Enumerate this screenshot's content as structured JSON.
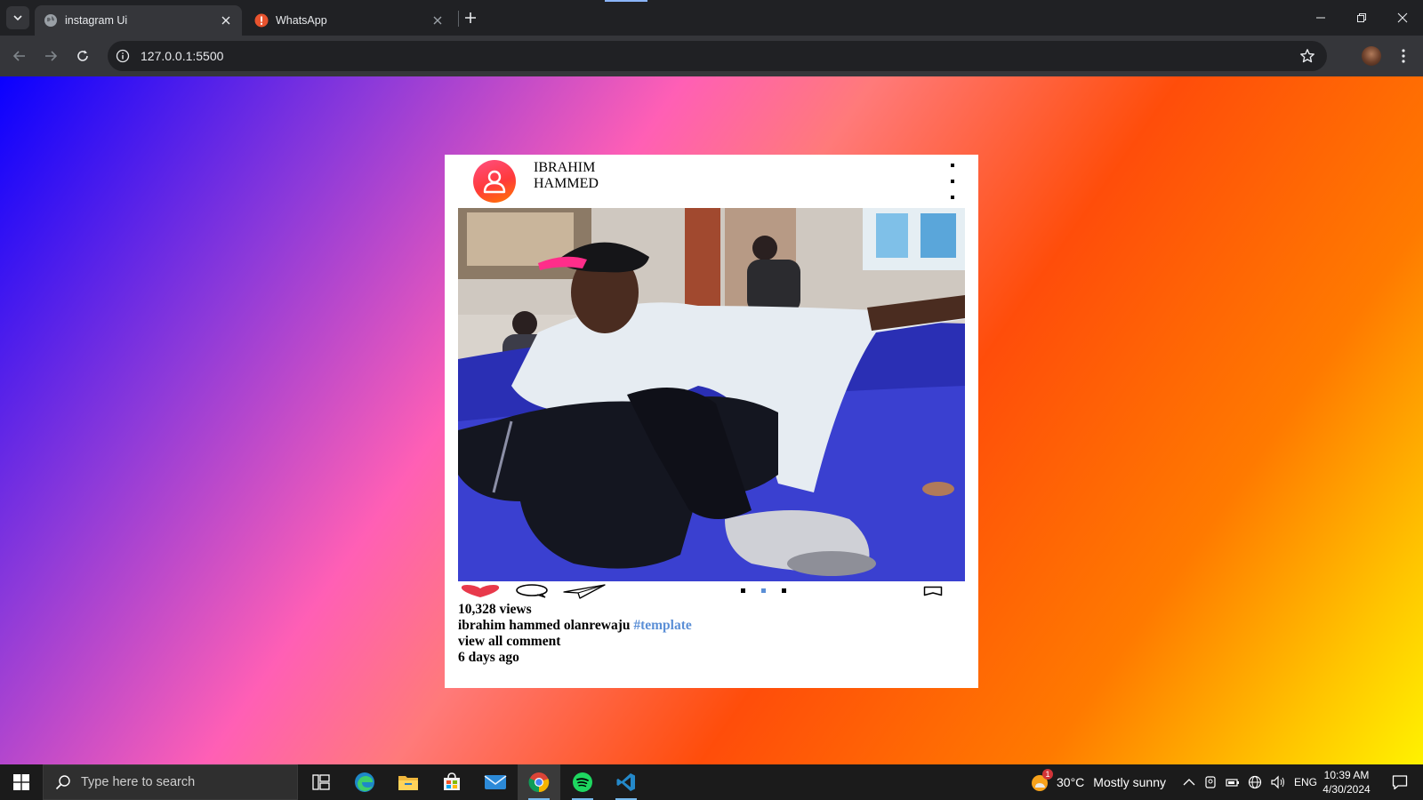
{
  "browser": {
    "tabs": [
      {
        "title": "instagram Ui",
        "active": true,
        "icon": "globe-icon"
      },
      {
        "title": "WhatsApp",
        "active": false,
        "icon": "whatsapp-error-icon"
      }
    ],
    "url": "127.0.0.1:5500"
  },
  "post": {
    "username": "IBRAHIM HAMMED",
    "views": "10,328 views",
    "caption_user": "ibrahim hammed olanrewaju",
    "caption_tag": "#template",
    "view_comments": "view all comment",
    "time_ago": "6 days ago",
    "pager": {
      "count": 3,
      "active_index": 1
    },
    "accent_color": "#5b8fd6",
    "like_color": "#e8394b"
  },
  "taskbar": {
    "search_placeholder": "Type here to search",
    "apps": [
      "task-view",
      "edge",
      "file-explorer",
      "microsoft-store",
      "mail",
      "chrome",
      "spotify",
      "vscode"
    ],
    "weather": {
      "temp": "30°C",
      "condition": "Mostly sunny",
      "badge": "1"
    },
    "language": "ENG",
    "time": "10:39 AM",
    "date": "4/30/2024"
  }
}
